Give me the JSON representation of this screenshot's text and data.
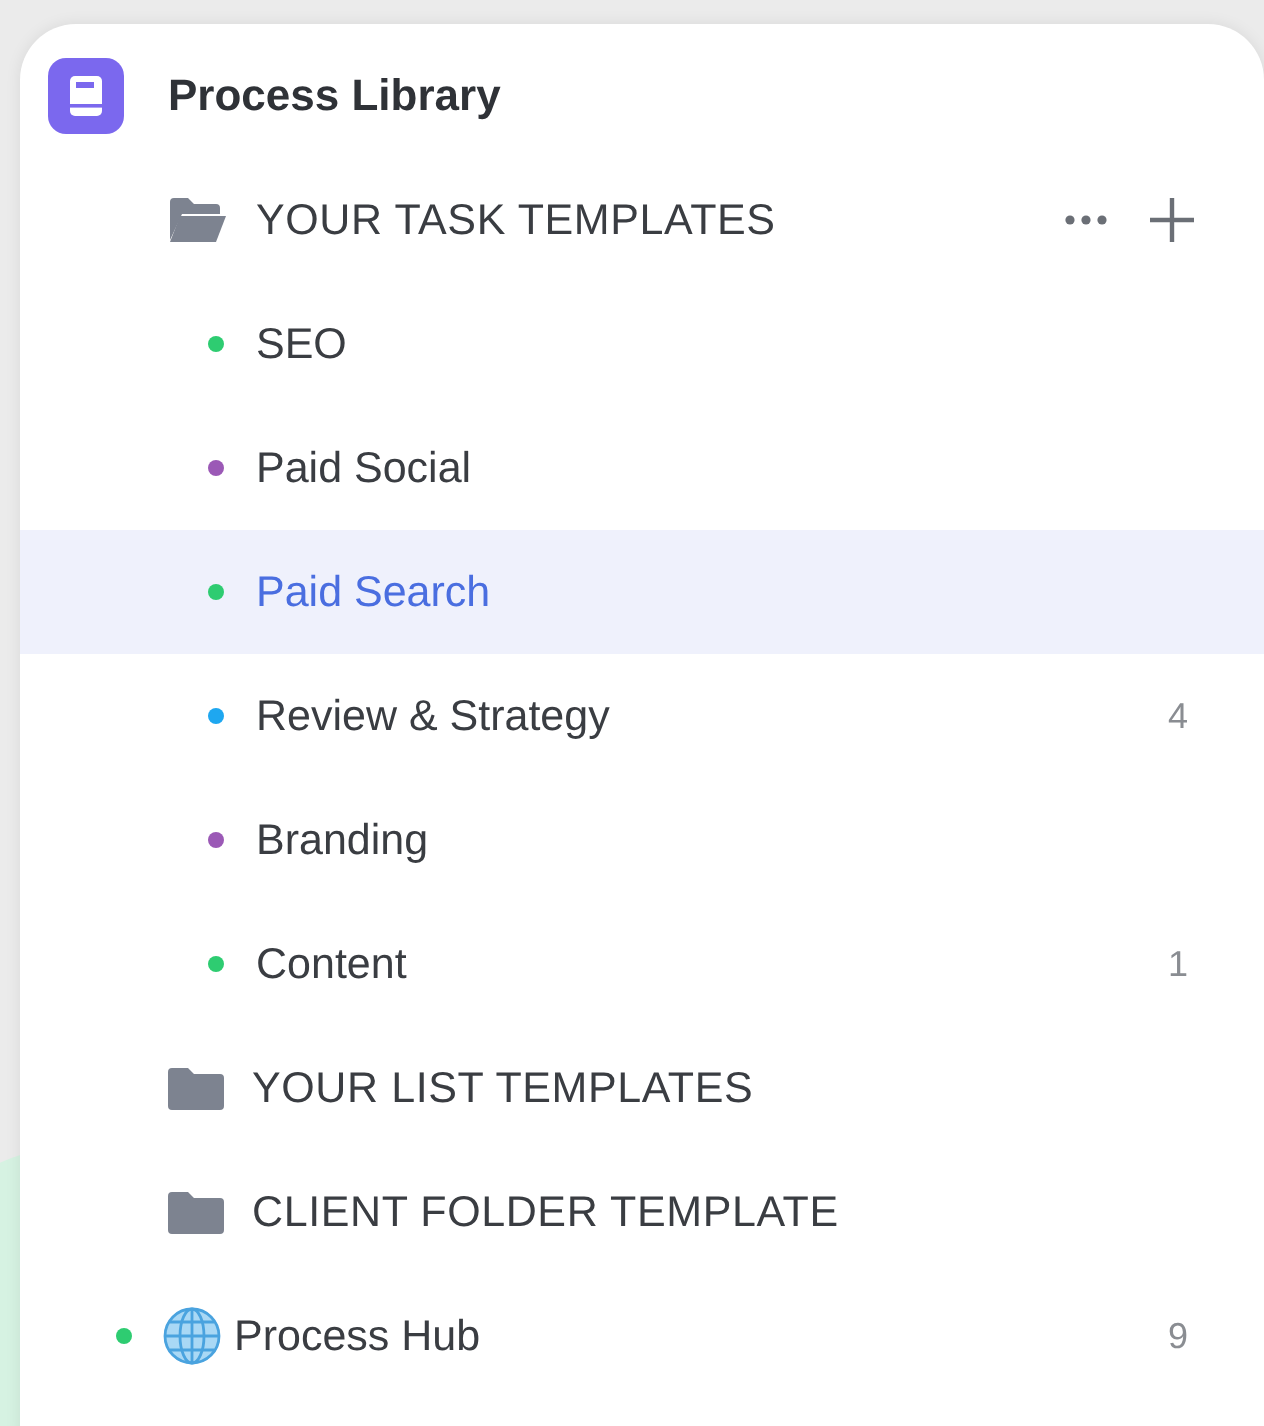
{
  "library": {
    "title": "Process Library"
  },
  "folders": [
    {
      "label": "YOUR TASK TEMPLATES",
      "expanded": true,
      "actions": true,
      "items": [
        {
          "name": "SEO",
          "color": "#2ecc71",
          "selected": false
        },
        {
          "name": "Paid Social",
          "color": "#9b59b6",
          "selected": false
        },
        {
          "name": "Paid Search",
          "color": "#2ecc71",
          "selected": true
        },
        {
          "name": "Review & Strategy",
          "color": "#1ea7f0",
          "selected": false,
          "count": "4"
        },
        {
          "name": "Branding",
          "color": "#9b59b6",
          "selected": false
        },
        {
          "name": "Content",
          "color": "#2ecc71",
          "selected": false,
          "count": "1"
        }
      ]
    },
    {
      "label": "YOUR LIST TEMPLATES",
      "expanded": false,
      "actions": false
    },
    {
      "label": "CLIENT FOLDER TEMPLATE",
      "expanded": false,
      "actions": false
    }
  ],
  "hub": {
    "name": "Process Hub",
    "color": "#2ecc71",
    "count": "9"
  }
}
